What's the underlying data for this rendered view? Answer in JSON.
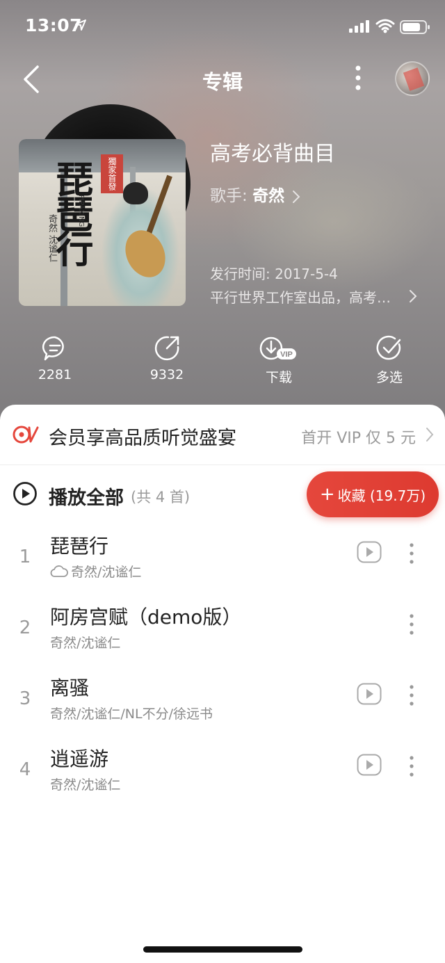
{
  "status_bar": {
    "time": "13:07"
  },
  "nav": {
    "title": "专辑"
  },
  "album": {
    "cover_title": "琵琶行",
    "cover_seal": "獨家首發",
    "cover_artists": "奇然 沈谧仁",
    "cover_pinyin": "PIPAXING",
    "title": "高考必背曲目",
    "singer_label": "歌手:",
    "singer": "奇然",
    "release": "发行时间: 2017-5-4",
    "description": "平行世界工作室出品，高考必背曲目"
  },
  "actions": [
    {
      "label": "2281",
      "icon": "comment-icon"
    },
    {
      "label": "9332",
      "icon": "share-icon"
    },
    {
      "label": "下载",
      "icon": "download-vip-icon",
      "badge": "VIP"
    },
    {
      "label": "多选",
      "icon": "multiselect-icon"
    }
  ],
  "vip_banner": {
    "text": "会员享高品质听觉盛宴",
    "cta": "首开 VIP 仅 5 元"
  },
  "playlist": {
    "play_all": "播放全部",
    "count": "(共 4 首)",
    "collect_plus": "+",
    "collect": "收藏 (19.7万)"
  },
  "songs": [
    {
      "num": "1",
      "name": "琵琶行",
      "artist": "奇然/沈谧仁",
      "cloud": true,
      "mv": true
    },
    {
      "num": "2",
      "name": "阿房宫赋（demo版）",
      "artist": "奇然/沈谧仁",
      "cloud": false,
      "mv": false
    },
    {
      "num": "3",
      "name": "离骚",
      "artist": "奇然/沈谧仁/NL不分/徐远书",
      "cloud": false,
      "mv": true
    },
    {
      "num": "4",
      "name": "逍遥游",
      "artist": "奇然/沈谧仁",
      "cloud": false,
      "mv": true
    }
  ],
  "colors": {
    "accent": "#e5473c",
    "text": "#222222",
    "muted": "#8a8a8a"
  }
}
